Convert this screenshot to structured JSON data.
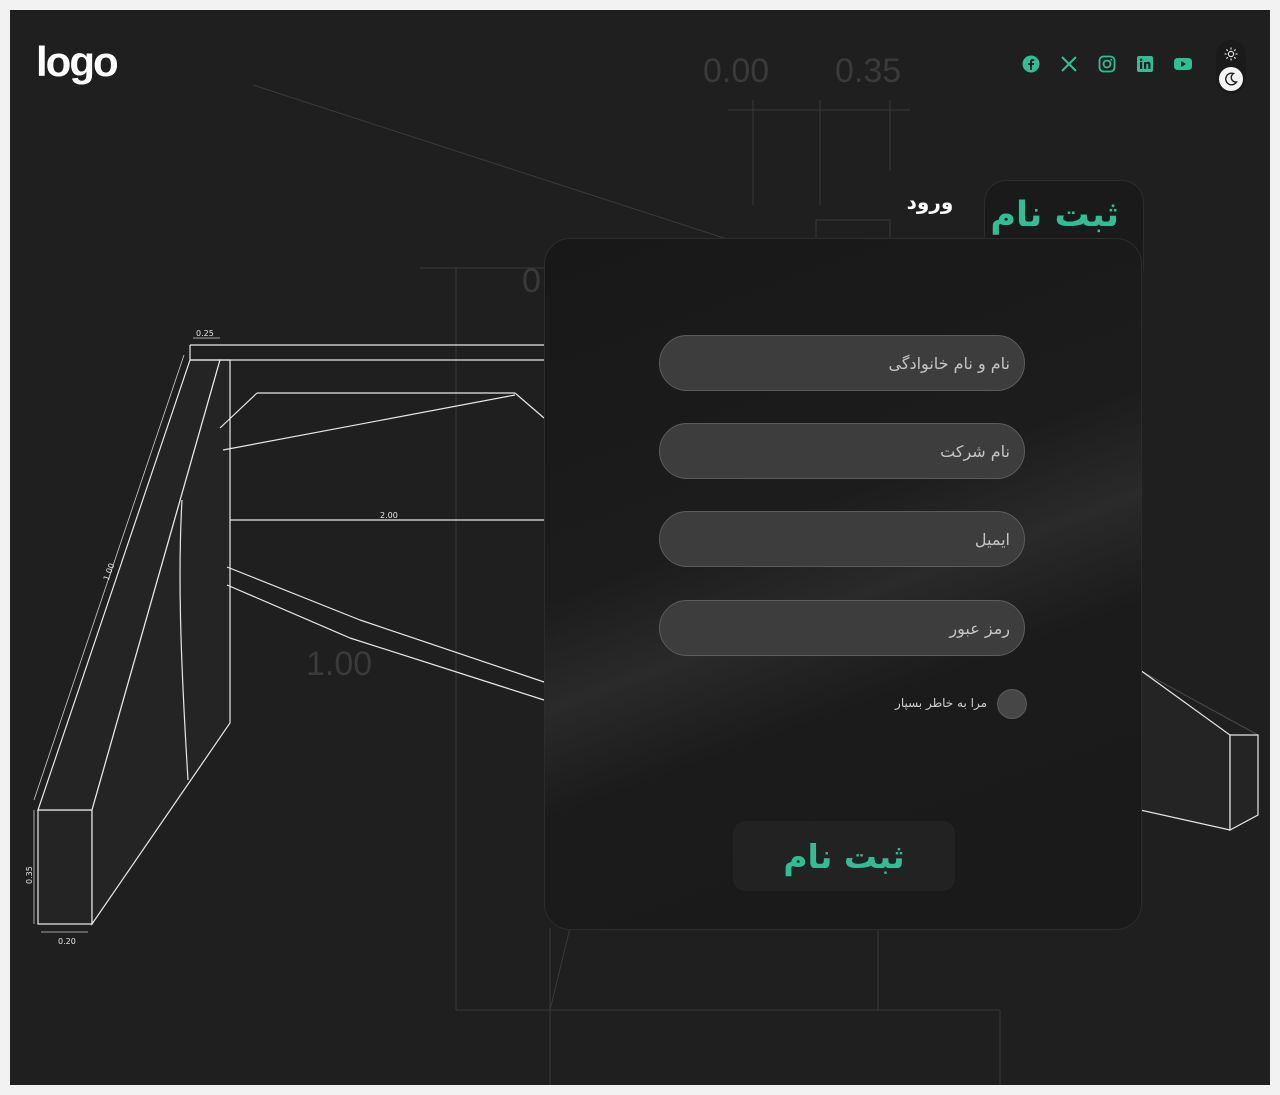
{
  "header": {
    "logo_text": "logo",
    "social_icons": [
      "facebook-icon",
      "x-icon",
      "instagram-icon",
      "linkedin-icon",
      "youtube-icon"
    ],
    "theme_icons": [
      "sun-icon",
      "moon-icon"
    ]
  },
  "background": {
    "dimension_labels": [
      "0.00",
      "0.35",
      "0.25",
      "2.00",
      "1.00",
      "1.00",
      "0.35",
      "0.20",
      "0"
    ]
  },
  "tabs": {
    "signup_label": "ثبت نام",
    "login_label": "ورود"
  },
  "form": {
    "fullname_placeholder": "نام و نام خانوادگی",
    "company_placeholder": "نام شرکت",
    "email_placeholder": "ایمیل",
    "password_placeholder": "رمز عبور",
    "remember_label": "مرا به خاطر بسپار",
    "submit_label": "ثبت نام"
  },
  "colors": {
    "accent": "#2fbf95",
    "background": "#1f1f1f",
    "card": "#1a1a1a",
    "field": "#3d3d3d"
  }
}
